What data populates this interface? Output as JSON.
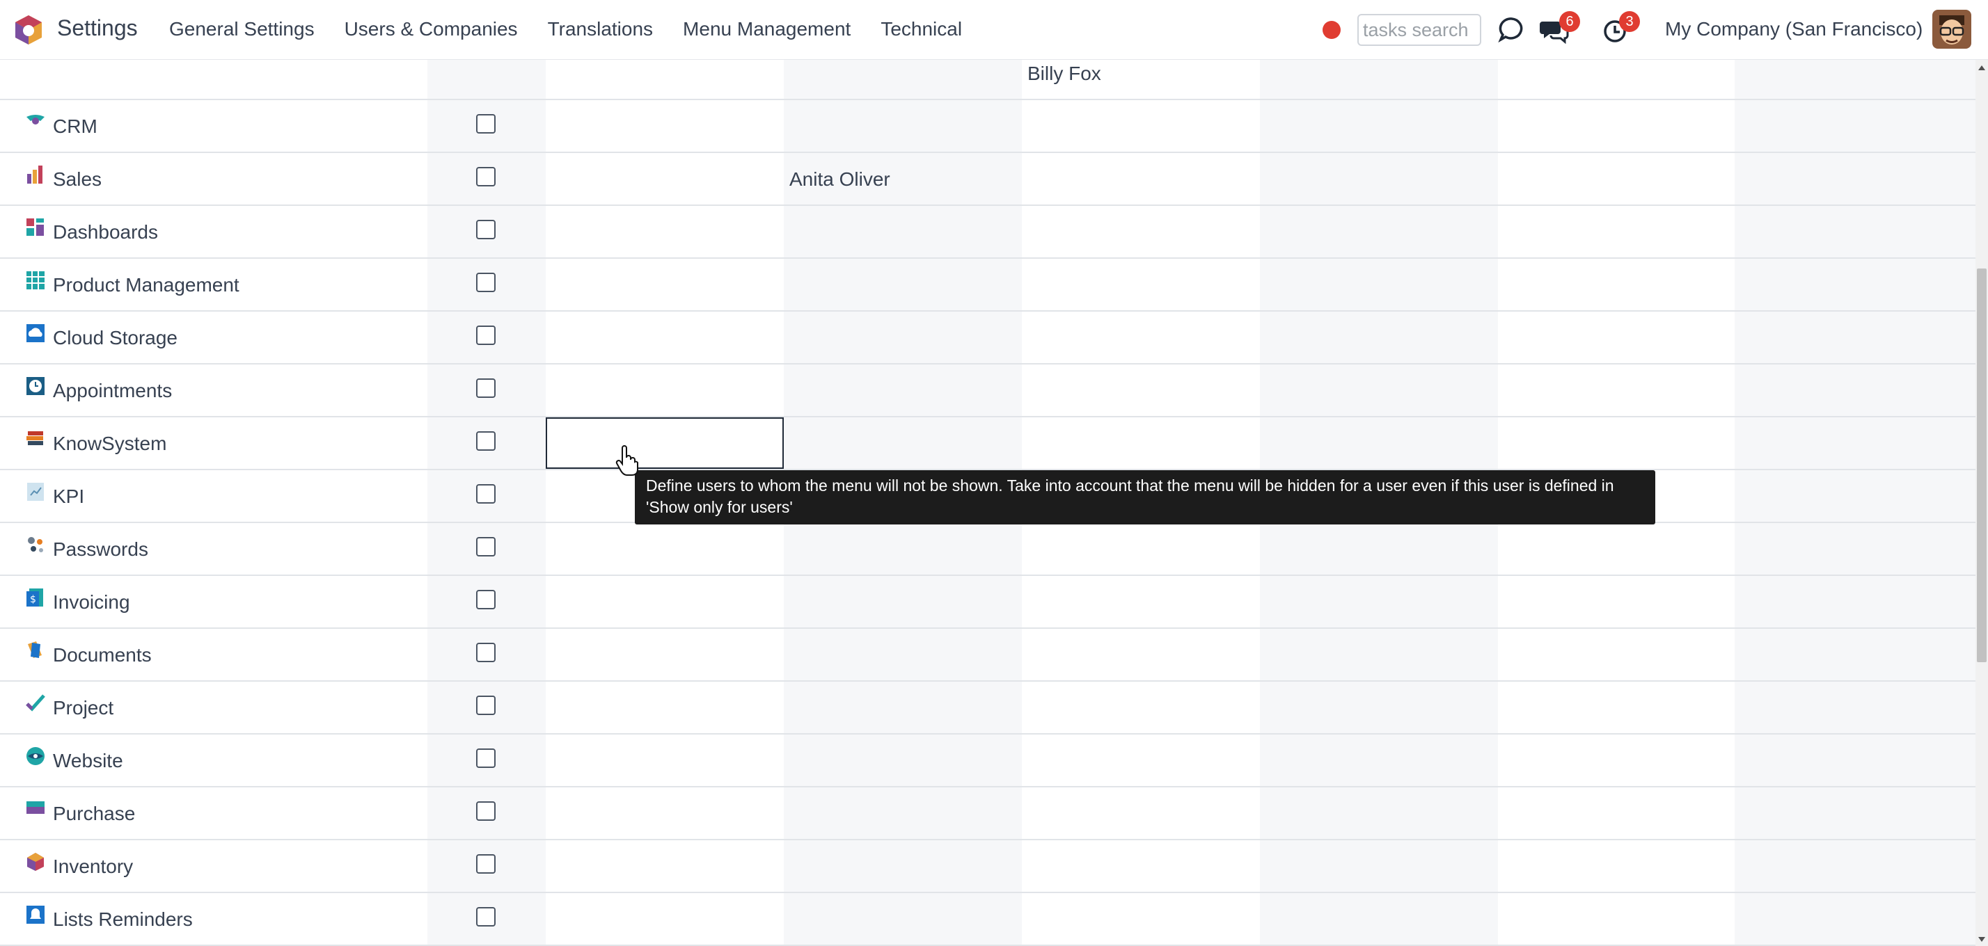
{
  "navbar": {
    "app_title": "Settings",
    "menu": [
      "General Settings",
      "Users & Companies",
      "Translations",
      "Menu Management",
      "Technical"
    ],
    "search_placeholder": "tasks search",
    "messages_count": "6",
    "activities_count": "3",
    "company": "My Company (San Francisco)"
  },
  "header_row": {
    "billy_fox": "Billy Fox"
  },
  "rows": [
    {
      "label": "CRM",
      "icon": "crm-icon"
    },
    {
      "label": "Sales",
      "icon": "sales-icon",
      "extra": "Anita Oliver"
    },
    {
      "label": "Dashboards",
      "icon": "dashboards-icon"
    },
    {
      "label": "Product Management",
      "icon": "product-management-icon"
    },
    {
      "label": "Cloud Storage",
      "icon": "cloud-storage-icon"
    },
    {
      "label": "Appointments",
      "icon": "appointments-icon"
    },
    {
      "label": "KnowSystem",
      "icon": "knowsystem-icon"
    },
    {
      "label": "KPI",
      "icon": "kpi-icon"
    },
    {
      "label": "Passwords",
      "icon": "passwords-icon"
    },
    {
      "label": "Invoicing",
      "icon": "invoicing-icon"
    },
    {
      "label": "Documents",
      "icon": "documents-icon"
    },
    {
      "label": "Project",
      "icon": "project-icon"
    },
    {
      "label": "Website",
      "icon": "website-icon"
    },
    {
      "label": "Purchase",
      "icon": "purchase-icon"
    },
    {
      "label": "Inventory",
      "icon": "inventory-icon"
    },
    {
      "label": "Lists Reminders",
      "icon": "lists-reminders-icon"
    }
  ],
  "tooltip": "Define users to whom the menu will not be shown. Take into account that the menu will be hidden for a user even if this user is defined in 'Show only for users'",
  "colors": {
    "accent": "#714b67",
    "badge": "#e03c31",
    "tooltip_bg": "#1c1c1c",
    "stripe": "#f6f7f9"
  }
}
